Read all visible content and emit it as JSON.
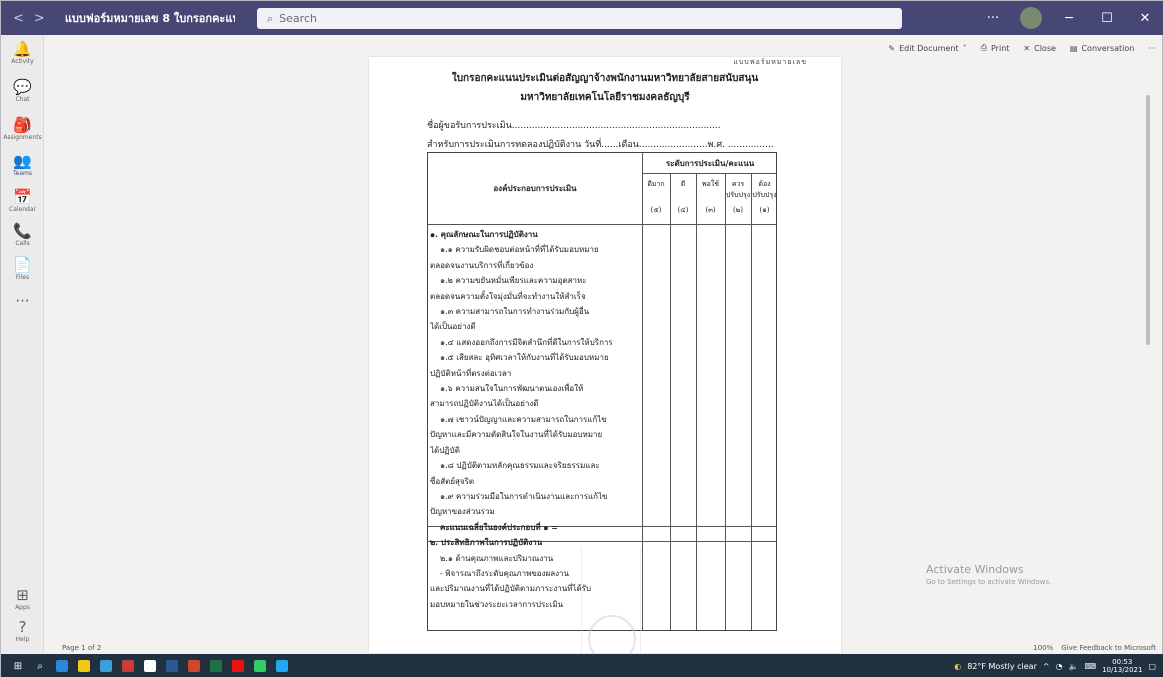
{
  "titlebar": {
    "doc_title": "แบบฟอร์มหมายเลข 8 ใบกรอกคะแนนประเ...",
    "search_placeholder": "Search"
  },
  "rail": [
    {
      "icon": "bell-icon",
      "glyph": "🔔",
      "label": "Activity"
    },
    {
      "icon": "chat-icon",
      "glyph": "💬",
      "label": "Chat"
    },
    {
      "icon": "assignments-icon",
      "glyph": "🎒",
      "label": "Assignments"
    },
    {
      "icon": "teams-icon",
      "glyph": "👥",
      "label": "Teams"
    },
    {
      "icon": "calendar-icon",
      "glyph": "📅",
      "label": "Calendar"
    },
    {
      "icon": "calls-icon",
      "glyph": "📞",
      "label": "Calls"
    },
    {
      "icon": "files-icon",
      "glyph": "📄",
      "label": "Files"
    },
    {
      "icon": "more-icon",
      "glyph": "···",
      "label": ""
    },
    {
      "icon": "apps-icon",
      "glyph": "⊞",
      "label": "Apps"
    },
    {
      "icon": "help-icon",
      "glyph": "?",
      "label": "Help"
    }
  ],
  "docbar": {
    "edit": "Edit Document",
    "print": "Print",
    "close": "Close",
    "conversation": "Conversation"
  },
  "document": {
    "corner": "แบบฟอร์มหมายเลข",
    "title_line1": "ใบกรอกคะแนนประเมินต่อสัญญาจ้างพนักงานมหาวิทยาลัยสายสนับสนุน",
    "title_line2": "มหาวิทยาลัยเทคโนโลยีราชมงคลธัญบุรี",
    "field1": "ชื่อผู้ขอรับการประเมิน.........................................................................",
    "field2": "สำหรับการประเมินการทดลองปฏิบัติงาน วันที่......เดือน........................พ.ศ. ................",
    "table": {
      "header_left": "องค์ประกอบการประเมิน",
      "header_right": "ระดับการประเมิน/คะแนน",
      "cols": [
        {
          "label": "ดีมาก",
          "score": "(๕)"
        },
        {
          "label": "ดี",
          "score": "(๔)"
        },
        {
          "label": "พอใช้",
          "score": "(๓)"
        },
        {
          "label": "ควรปรับปรุง",
          "score": "(๒)"
        },
        {
          "label": "ต้องปรับปรุง",
          "score": "(๑)"
        }
      ],
      "lines": [
        {
          "text": "๑. คุณลักษณะในการปฏิบัติงาน",
          "bold": true
        },
        {
          "text": "๑.๑ ความรับผิดชอบต่อหน้าที่ที่ได้รับมอบหมาย",
          "indent": true
        },
        {
          "text": "ตลอดจนงานบริการที่เกี่ยวข้อง"
        },
        {
          "text": "๑.๒ ความขยันหมั่นเพียรและความอุตสาหะ",
          "indent": true
        },
        {
          "text": "ตลอดจนความตั้งใจมุ่งมั่นที่จะทำงานให้สำเร็จ"
        },
        {
          "text": "๑.๓ ความสามารถในการทำงานร่วมกับผู้อื่น",
          "indent": true
        },
        {
          "text": "ได้เป็นอย่างดี"
        },
        {
          "text": "๑.๔ แสดงออกถึงการมีจิตสำนึกที่ดีในการให้บริการ",
          "indent": true
        },
        {
          "text": "๑.๕ เสียสละ อุทิศเวลาให้กับงานที่ได้รับมอบหมาย",
          "indent": true
        },
        {
          "text": "ปฏิบัติหน้าที่ตรงต่อเวลา"
        },
        {
          "text": "๑.๖ ความสนใจในการพัฒนาตนเองเพื่อให้",
          "indent": true
        },
        {
          "text": "สามารถปฏิบัติงานได้เป็นอย่างดี"
        },
        {
          "text": "๑.๗ เชาวน์ปัญญาและความสามารถในการแก้ไข",
          "indent": true
        },
        {
          "text": "ปัญหาและมีความตัดสินใจในงานที่ได้รับมอบหมาย"
        },
        {
          "text": "ได้ปฏิบัติ"
        },
        {
          "text": "๑.๘ ปฏิบัติตามหลักคุณธรรมและจริยธรรมและ",
          "indent": true
        },
        {
          "text": "ซื่อสัตย์สุจริต"
        },
        {
          "text": "๑.๙ ความร่วมมือในการดำเนินงานและการแก้ไข",
          "indent": true
        },
        {
          "text": "ปัญหาของส่วนรวม"
        },
        {
          "text": "คะแนนเฉลี่ยในองค์ประกอบที่ ๑ =",
          "bold": true,
          "indent": true
        },
        {
          "text": "๒. ประสิทธิภาพในการปฏิบัติงาน",
          "bold": true
        },
        {
          "text": "๒.๑ ด้านคุณภาพและปริมาณงาน",
          "indent": true
        },
        {
          "text": "- พิจารณาถึงระดับคุณภาพของผลงาน",
          "indent": true
        },
        {
          "text": "และปริมาณงานที่ได้ปฏิบัติตามภาระงานที่ได้รับ"
        },
        {
          "text": "มอบหมายในช่วงระยะเวลาการประเมิน"
        }
      ]
    }
  },
  "activate": {
    "title": "Activate Windows",
    "subtitle": "Go to Settings to activate Windows."
  },
  "status": {
    "page": "Page 1 of 2",
    "zoom": "100%",
    "feedback": "Give Feedback to Microsoft"
  },
  "taskbar": {
    "weather": "82°F  Mostly clear",
    "time": "00:53",
    "date": "10/13/2021",
    "apps": [
      "#2b88d8",
      "#f2c811",
      "#3aa0d8",
      "#cb3a3a",
      "#ffffff",
      "#2b5797",
      "#d24726",
      "#1e7145",
      "#ee1111",
      "#33cc66",
      "#22a7f0"
    ]
  }
}
